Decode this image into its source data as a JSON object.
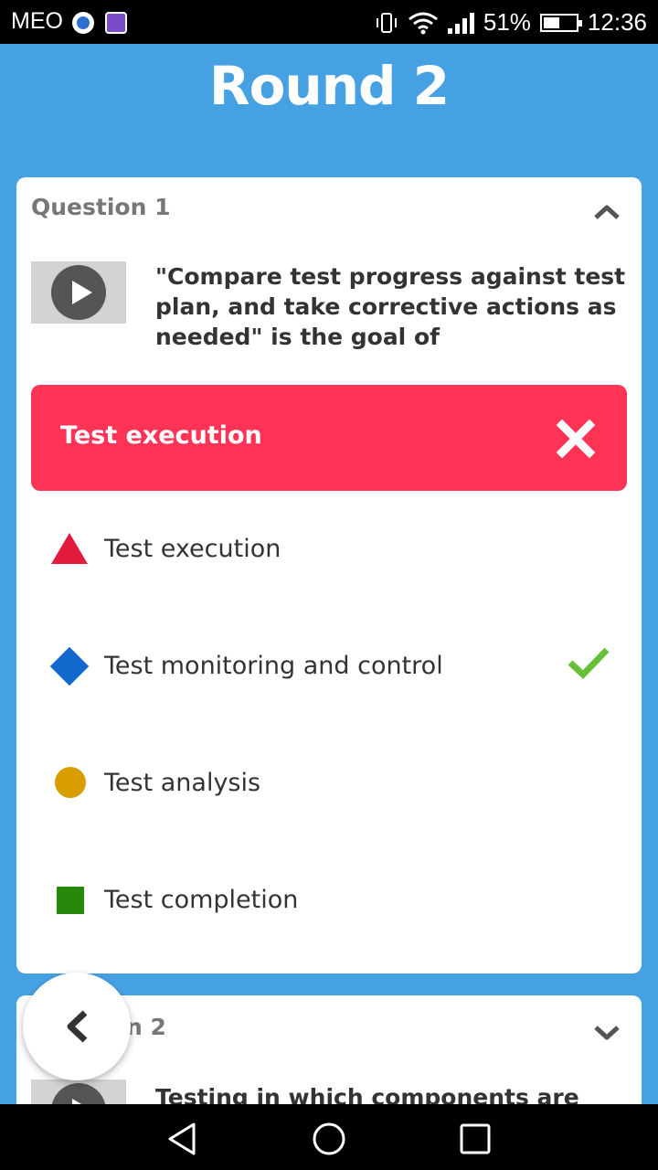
{
  "status_bar": {
    "carrier": "MEO",
    "battery_percent": "51%",
    "battery_level": 0.51,
    "time": "12:36"
  },
  "header": {
    "title": "Round 2"
  },
  "question1": {
    "header": "Question 1",
    "text": "\"Compare test progress against test plan, and take corrective actions as needed\" is the goal of",
    "selected_answer": "Test execution",
    "selected_result": "incorrect",
    "options": [
      {
        "label": "Test execution",
        "shape": "triangle",
        "color": "#E21B3C",
        "correct": false
      },
      {
        "label": "Test monitoring and control",
        "shape": "diamond",
        "color": "#1368CE",
        "correct": true
      },
      {
        "label": "Test analysis",
        "shape": "circle",
        "color": "#D89E00",
        "correct": false
      },
      {
        "label": "Test completion",
        "shape": "square",
        "color": "#26890C",
        "correct": false
      }
    ]
  },
  "question2": {
    "header_partial": "n 2",
    "text_partial": "Testing in which components are"
  },
  "colors": {
    "background": "#46A1E3",
    "wrong": "#FF3355",
    "check": "#66BF39"
  }
}
